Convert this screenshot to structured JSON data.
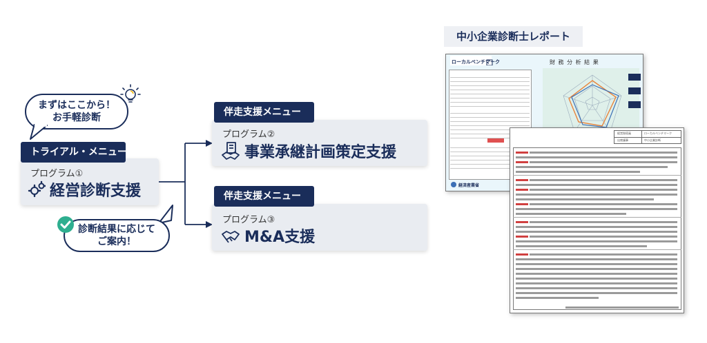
{
  "bubble_top": {
    "line1": "まずはここから！",
    "line2": "お手軽診断"
  },
  "bubble_bottom": {
    "line1": "診断結果に応じて",
    "line2": "ご案内！"
  },
  "trial": {
    "tag": "トライアル・メニュー",
    "program": "プログラム①",
    "title": "経営診断支援"
  },
  "program2": {
    "tag": "伴走支援メニュー",
    "program": "プログラム②",
    "title": "事業承継計画策定支援"
  },
  "program3": {
    "tag": "伴走支援メニュー",
    "program": "プログラム③",
    "title": "M&A支援"
  },
  "report": {
    "title": "中小企業診断士レポート",
    "front_logo": "ローカルベンチマーク",
    "front_chart_title": "財 務 分 析 結 果",
    "ministry": "経済産業省",
    "back_header_left": "経営指導員",
    "back_header_right": "ローカルベンチマーク",
    "back_header_left2": "出席議事",
    "back_header_right2": "中小企業診断"
  },
  "colors": {
    "navy": "#1a2d5a",
    "check_green": "#2eae8f",
    "radar_orange": "#e8833a",
    "radar_blue": "#3b6fb6"
  }
}
